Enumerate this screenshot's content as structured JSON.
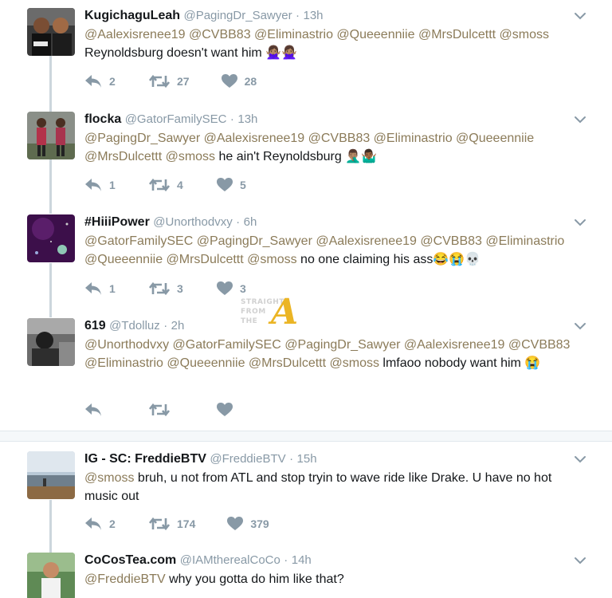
{
  "tweets": [
    {
      "name": "KugichaguLeah",
      "handle": "@PagingDr_Sawyer",
      "dot": "·",
      "time": "13h",
      "mentions": "@Aalexisrenee19 @CVBB83 @Eliminastrio @Queeenniie @MrsDulcettt @smoss",
      "text": "Reynoldsburg doesn't want him 🙅🏽‍♀️🙅🏽‍♀️",
      "replies": "2",
      "retweets": "27",
      "likes": "28"
    },
    {
      "name": "flocka",
      "handle": "@GatorFamilySEC",
      "dot": "·",
      "time": "13h",
      "mentions": "@PagingDr_Sawyer @Aalexisrenee19 @CVBB83 @Eliminastrio @Queeenniie @MrsDulcettt @smoss",
      "text": "he ain't Reynoldsburg 🤦🏽‍♂️🤷🏾‍♂️",
      "replies": "1",
      "retweets": "4",
      "likes": "5"
    },
    {
      "name": "#HiiiPower",
      "handle": "@Unorthodvxy",
      "dot": "·",
      "time": "6h",
      "mentions": "@GatorFamilySEC @PagingDr_Sawyer @Aalexisrenee19 @CVBB83 @Eliminastrio @Queeenniie @MrsDulcettt @smoss",
      "text": "no one claiming his ass😂😭💀",
      "replies": "1",
      "retweets": "3",
      "likes": "3"
    },
    {
      "name": "619",
      "handle": "@Tdolluz",
      "dot": "·",
      "time": "2h",
      "mentions": "@Unorthodvxy @GatorFamilySEC @PagingDr_Sawyer @Aalexisrenee19 @CVBB83 @Eliminastrio @Queeenniie @MrsDulcettt @smoss",
      "text": "lmfaoo nobody want him 😭",
      "replies": "",
      "retweets": "",
      "likes": ""
    },
    {
      "name": "IG - SC: FreddieBTV",
      "handle": "@FreddieBTV",
      "dot": "·",
      "time": "15h",
      "mentions": "@smoss",
      "text": "bruh, u not from ATL and stop tryin to wave ride like Drake. U have no hot music out",
      "replies": "2",
      "retweets": "174",
      "likes": "379"
    },
    {
      "name": "CoCosTea.com",
      "handle": "@IAMtherealCoCo",
      "dot": "·",
      "time": "14h",
      "mentions": "@FreddieBTV",
      "text": "why you gotta do him like that?",
      "replies": "",
      "retweets": "",
      "likes": ""
    }
  ],
  "watermark": {
    "line1": "STRAIGHT",
    "line2": "FROM",
    "line3": "THE",
    "letter": "A"
  },
  "colors": {
    "mention": "#8b7b59",
    "muted": "#8899a6",
    "thread": "#ccd6dd",
    "watermark_gold": "#e8a900"
  },
  "icons": {
    "reply": "reply-icon",
    "retweet": "retweet-icon",
    "like": "heart-icon",
    "menu": "chevron-down-icon"
  }
}
